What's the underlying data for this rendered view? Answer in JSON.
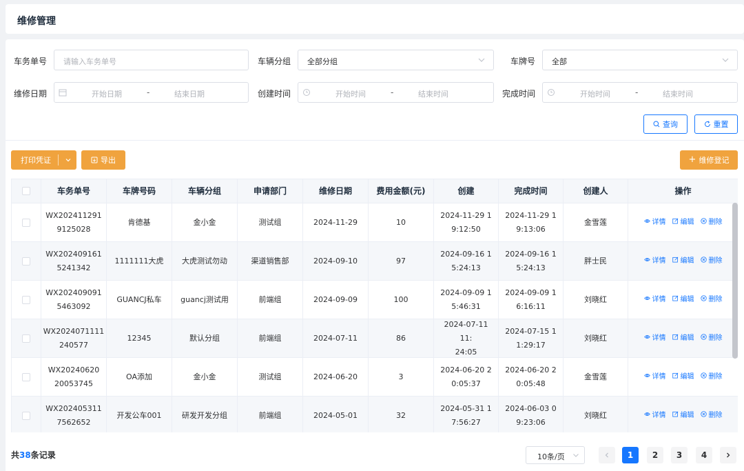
{
  "header": {
    "title": "维修管理"
  },
  "filters": {
    "order_no": {
      "label": "车务单号",
      "placeholder": "请输入车务单号"
    },
    "vehicle_group": {
      "label": "车辆分组",
      "value": "全部分组"
    },
    "plate": {
      "label": "车牌号",
      "value": "全部"
    },
    "repair_date": {
      "label": "维修日期",
      "start": "开始日期",
      "sep": "-",
      "end": "结束日期"
    },
    "create_time": {
      "label": "创建时间",
      "start": "开始时间",
      "sep": "-",
      "end": "结束时间"
    },
    "finish_time": {
      "label": "完成时间",
      "start": "开始时间",
      "sep": "-",
      "end": "结束时间"
    },
    "query_label": "查询",
    "reset_label": "重置"
  },
  "toolbar": {
    "print_label": "打印凭证",
    "export_label": "导出",
    "register_label": "维修登记"
  },
  "table": {
    "headers": [
      "车务单号",
      "车牌号码",
      "车辆分组",
      "申请部门",
      "维修日期",
      "费用金额(元)",
      "创建",
      "完成时间",
      "创建人",
      "操作"
    ],
    "ops": {
      "detail": "详情",
      "edit": "编辑",
      "delete": "删除"
    },
    "rows": [
      {
        "order_1": "WX202411291",
        "order_2": "9125028",
        "plate": "肯德基",
        "group": "金小金",
        "dept": "测试组",
        "date": "2024-11-29",
        "amount": "10",
        "created_1": "2024-11-29 1",
        "created_2": "9:12:50",
        "finished_1": "2024-11-29 1",
        "finished_2": "9:13:06",
        "creator": "金雪莲"
      },
      {
        "order_1": "WX202409161",
        "order_2": "5241342",
        "plate": "1111111大虎",
        "group": "大虎测试勿动",
        "dept": "渠道销售部",
        "date": "2024-09-10",
        "amount": "97",
        "created_1": "2024-09-16 1",
        "created_2": "5:24:13",
        "finished_1": "2024-09-16 1",
        "finished_2": "5:24:13",
        "creator": "胖士民"
      },
      {
        "order_1": "WX202409091",
        "order_2": "5463092",
        "plate": "GUANCJ私车",
        "group": "guancj测试用",
        "dept": "前端组",
        "date": "2024-09-09",
        "amount": "100",
        "created_1": "2024-09-09 1",
        "created_2": "5:46:31",
        "finished_1": "2024-09-09 1",
        "finished_2": "6:16:11",
        "creator": "刘晓红"
      },
      {
        "order_1": "WX2024071111",
        "order_2": "240577",
        "plate": "12345",
        "group": "默认分组",
        "dept": "前端组",
        "date": "2024-07-11",
        "amount": "86",
        "created_1": "2024-07-11 11:",
        "created_2": "24:05",
        "finished_1": "2024-07-15 1",
        "finished_2": "1:29:17",
        "creator": "刘晓红"
      },
      {
        "order_1": "WX20240620",
        "order_2": "20053745",
        "plate": "OA添加",
        "group": "金小金",
        "dept": "测试组",
        "date": "2024-06-20",
        "amount": "3",
        "created_1": "2024-06-20 2",
        "created_2": "0:05:37",
        "finished_1": "2024-06-20 2",
        "finished_2": "0:05:48",
        "creator": "金雪莲"
      },
      {
        "order_1": "WX202405311",
        "order_2": "7562652",
        "plate": "开发公车001",
        "group": "研发开发分组",
        "dept": "前端组",
        "date": "2024-05-01",
        "amount": "32",
        "created_1": "2024-05-31 1",
        "created_2": "7:56:27",
        "finished_1": "2024-06-03 0",
        "finished_2": "9:23:06",
        "creator": "刘晓红"
      }
    ]
  },
  "pagination": {
    "total_prefix": "共",
    "total": "38",
    "total_suffix": "条记录",
    "page_size": "10条/页",
    "pages": [
      "1",
      "2",
      "3",
      "4"
    ],
    "current": "1"
  },
  "colors": {
    "accent": "#1677ff",
    "orange": "#f0a33e"
  }
}
